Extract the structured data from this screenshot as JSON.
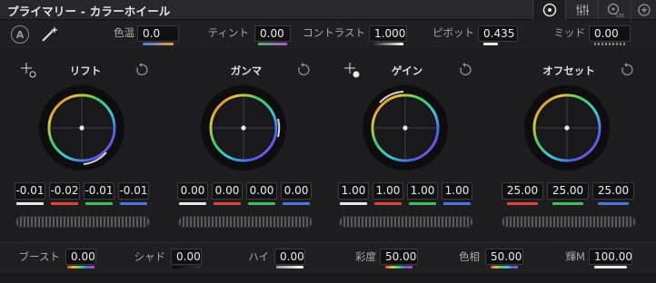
{
  "title": "プライマリー - カラーホイール",
  "top_params": {
    "temp": {
      "label": "色温",
      "value": "0.0"
    },
    "tint": {
      "label": "ティント",
      "value": "0.00"
    },
    "contrast": {
      "label": "コントラスト",
      "value": "1.000"
    },
    "pivot": {
      "label": "ピボット",
      "value": "0.435"
    },
    "mid": {
      "label": "ミッド",
      "value": "0.00"
    }
  },
  "auto_label": "A",
  "wheels": {
    "lift": {
      "title": "リフト",
      "values": [
        "-0.01",
        "-0.02",
        "-0.01",
        "-0.01"
      ]
    },
    "gamma": {
      "title": "ガンマ",
      "values": [
        "0.00",
        "0.00",
        "0.00",
        "0.00"
      ]
    },
    "gain": {
      "title": "ゲイン",
      "values": [
        "1.00",
        "1.00",
        "1.00",
        "1.00"
      ]
    },
    "offset": {
      "title": "オフセット",
      "values": [
        "25.00",
        "25.00",
        "25.00"
      ]
    }
  },
  "bottom_params": {
    "boost": {
      "label": "ブースト",
      "value": "0.00"
    },
    "shadow": {
      "label": "シャド",
      "value": "0.00"
    },
    "high": {
      "label": "ハイ",
      "value": "0.00"
    },
    "sat": {
      "label": "彩度",
      "value": "50.00"
    },
    "hue": {
      "label": "色相",
      "value": "50.00"
    },
    "lummix": {
      "label": "輝M",
      "value": "100.00"
    }
  },
  "colors": {
    "y": "#e8e8e8",
    "r": "#e0453a",
    "g": "#3dc25a",
    "b": "#4a78e6"
  }
}
